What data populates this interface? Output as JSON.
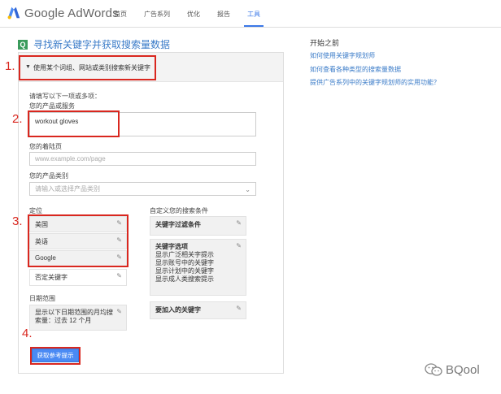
{
  "header": {
    "logo_text": "Google AdWords",
    "nav": [
      "首页",
      "广告系列",
      "优化",
      "报告",
      "工具"
    ],
    "active_index": 4
  },
  "page": {
    "title": "寻找新关键字并获取搜索量数据"
  },
  "panel": {
    "section_label": "使用某个词组、网站或类别搜索新关键字",
    "fill_hint": "请填写以下一项或多项：",
    "product_label": "您的产品或服务",
    "product_value": "workout gloves",
    "landing_label": "您的着陆页",
    "landing_placeholder": "www.example.com/page",
    "category_label": "您的产品类别",
    "category_placeholder": "请输入或选择产品类别",
    "targeting_label": "定位",
    "targeting_items": [
      "美国",
      "英语",
      "Google"
    ],
    "negative_keywords": "否定关键字",
    "date_label": "日期范围",
    "date_value": "显示以下日期范围的月均搜索量：过去 12 个月",
    "custom_label": "自定义您的搜索条件",
    "keyword_filters": "关键字过滤条件",
    "keyword_options_title": "关键字选项",
    "keyword_options": [
      "显示广泛相关字提示",
      "显示账号中的关键字",
      "显示计划中的关键字",
      "显示成人类搜索提示"
    ],
    "include_keywords": "要加入的关键字",
    "submit_label": "获取参考提示"
  },
  "annotations": [
    "1.",
    "2.",
    "3.",
    "4."
  ],
  "sidebar": {
    "title": "开始之前",
    "links": [
      "如何使用关键字规划师",
      "如何查看各种类型的搜索量数据",
      "提供广告系列中的关键字规划师的实用功能？"
    ]
  },
  "watermark": "BQool",
  "colors": {
    "accent": "#3b78e7",
    "annotation_red": "#d9271f",
    "brand_green": "#3a9b5c"
  }
}
